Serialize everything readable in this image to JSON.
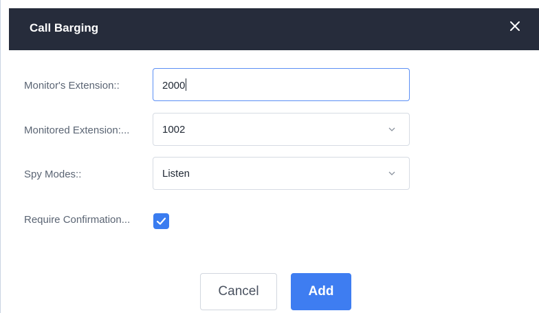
{
  "dialog": {
    "title": "Call Barging",
    "close_icon": "close-icon"
  },
  "form": {
    "monitor_extension": {
      "label": "Monitor's Extension::",
      "value": "2000"
    },
    "monitored_extension": {
      "label": "Monitored Extension:...",
      "value": "1002"
    },
    "spy_modes": {
      "label": "Spy Modes::",
      "value": "Listen"
    },
    "require_confirmation": {
      "label": "Require Confirmation...",
      "checked": true
    }
  },
  "buttons": {
    "cancel_label": "Cancel",
    "add_label": "Add"
  },
  "colors": {
    "titlebar": "#262c3b",
    "accent": "#3e7df1"
  }
}
